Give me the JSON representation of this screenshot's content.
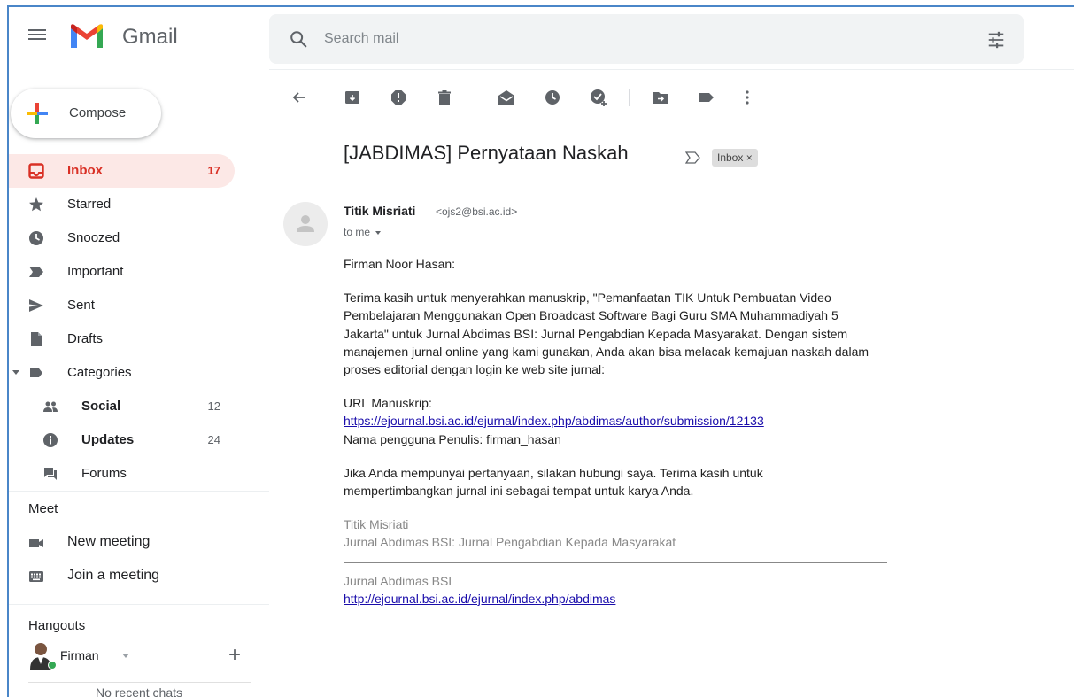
{
  "header": {
    "app_name": "Gmail",
    "search_placeholder": "Search mail"
  },
  "sidebar": {
    "compose_label": "Compose",
    "items": [
      {
        "label": "Inbox",
        "count": "17",
        "icon": "inbox-icon",
        "active": true
      },
      {
        "label": "Starred",
        "count": "",
        "icon": "star-icon"
      },
      {
        "label": "Snoozed",
        "count": "",
        "icon": "clock-icon"
      },
      {
        "label": "Important",
        "count": "",
        "icon": "important-icon"
      },
      {
        "label": "Sent",
        "count": "",
        "icon": "send-icon"
      },
      {
        "label": "Drafts",
        "count": "",
        "icon": "draft-icon"
      },
      {
        "label": "Categories",
        "count": "",
        "icon": "label-icon"
      }
    ],
    "categories": [
      {
        "label": "Social",
        "count": "12",
        "icon": "people-icon"
      },
      {
        "label": "Updates",
        "count": "24",
        "icon": "info-icon"
      },
      {
        "label": "Forums",
        "count": "",
        "icon": "forum-icon"
      }
    ],
    "meet": {
      "title": "Meet",
      "new_meeting": "New meeting",
      "join_meeting": "Join a meeting"
    },
    "hangouts": {
      "title": "Hangouts",
      "user": "Firman",
      "no_chats": "No recent chats"
    }
  },
  "message": {
    "subject": "[JABDIMAS] Pernyataan Naskah",
    "label_chip": "Inbox ×",
    "sender_name": "Titik Misriati",
    "sender_email": "<ojs2@bsi.ac.id>",
    "to": "to me",
    "greeting": "Firman Noor Hasan:",
    "paragraph1": "Terima kasih untuk menyerahkan manuskrip, \"Pemanfaatan TIK Untuk Pembuatan Video Pembelajaran Menggunakan Open Broadcast Software Bagi Guru SMA Muhammadiyah 5 Jakarta\" untuk Jurnal Abdimas BSI: Jurnal Pengabdian Kepada Masyarakat. Dengan sistem manajemen jurnal online yang kami gunakan, Anda akan bisa melacak kemajuan naskah dalam proses editorial dengan login ke web site jurnal:",
    "url_label": "URL Manuskrip:",
    "url": "https://ejournal.bsi.ac.id/ejurnal/index.php/abdimas/author/submission/12133",
    "username_line": "Nama pengguna Penulis: firman_hasan",
    "paragraph2": "Jika Anda mempunyai pertanyaan, silakan hubungi saya. Terima kasih untuk mempertimbangkan jurnal ini sebagai tempat untuk karya Anda.",
    "sig_name": "Titik Misriati",
    "sig_journal": "Jurnal Abdimas BSI: Jurnal Pengabdian Kepada Masyarakat",
    "footer_name": "Jurnal Abdimas BSI",
    "footer_url": "http://ejournal.bsi.ac.id/ejurnal/index.php/abdimas"
  },
  "colors": {
    "accent_red": "#d93025",
    "active_bg": "#fce8e6",
    "link": "#1a0dab"
  }
}
